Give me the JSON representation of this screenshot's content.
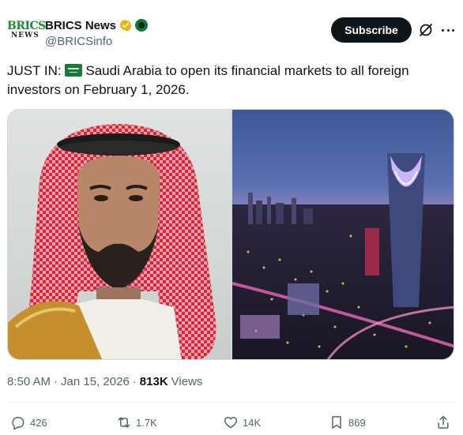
{
  "account": {
    "logo_text_top": "BRICS",
    "logo_text_bottom": "NEWS",
    "display_name": "BRICS News",
    "handle": "@BRICSinfo",
    "verified_icon": "gold-checkmark-badge-icon",
    "affiliate_icon": "affiliate-badge-icon"
  },
  "header": {
    "subscribe_label": "Subscribe",
    "grok_icon": "grok-icon",
    "more_icon": "more-horizontal-icon"
  },
  "tweet": {
    "prefix": "JUST IN: ",
    "flag_icon": "saudi-flag-icon",
    "body": "Saudi Arabia to open its financial markets to all foreign investors on February 1, 2026."
  },
  "media": {
    "left_image": "photo-man-red-keffiyeh",
    "right_image": "photo-riyadh-skyline-night"
  },
  "meta": {
    "time": "8:50 AM",
    "separator": "·",
    "date": "Jan 15, 2026",
    "separator2": "·",
    "views_count": "813K",
    "views_label": "Views"
  },
  "actions": {
    "replies": "426",
    "reposts": "1.7K",
    "likes": "14K",
    "bookmarks": "869"
  },
  "colors": {
    "text_primary": "#0f1419",
    "text_secondary": "#536471",
    "verified_gold": "#e2b719",
    "button_bg": "#0f1419"
  }
}
